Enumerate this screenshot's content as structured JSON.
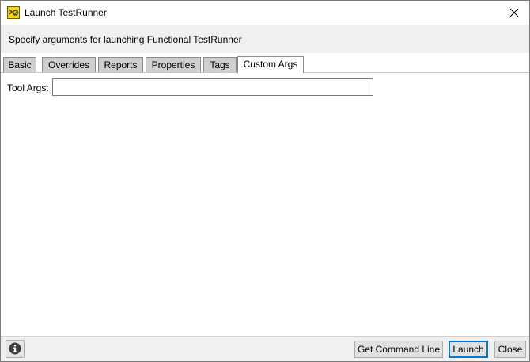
{
  "window": {
    "title": "Launch TestRunner",
    "icon": "testrunner-app-icon"
  },
  "header": {
    "text": "Specify arguments for launching Functional TestRunner"
  },
  "tabs": [
    {
      "label": "Basic",
      "active": false
    },
    {
      "label": "Overrides",
      "active": false
    },
    {
      "label": "Reports",
      "active": false
    },
    {
      "label": "Properties",
      "active": false
    },
    {
      "label": "Tags",
      "active": false
    },
    {
      "label": "Custom Args",
      "active": true
    }
  ],
  "form": {
    "tool_args_label": "Tool Args:",
    "tool_args_value": ""
  },
  "footer": {
    "info_icon": "info-icon",
    "get_command_line_label": "Get Command Line",
    "launch_label": "Launch",
    "close_label": "Close"
  },
  "colors": {
    "header_bg": "#f0f0f0",
    "tab_bg": "#cfcfcf",
    "default_button_border": "#0078d7",
    "icon_yellow": "#f5d90a"
  }
}
